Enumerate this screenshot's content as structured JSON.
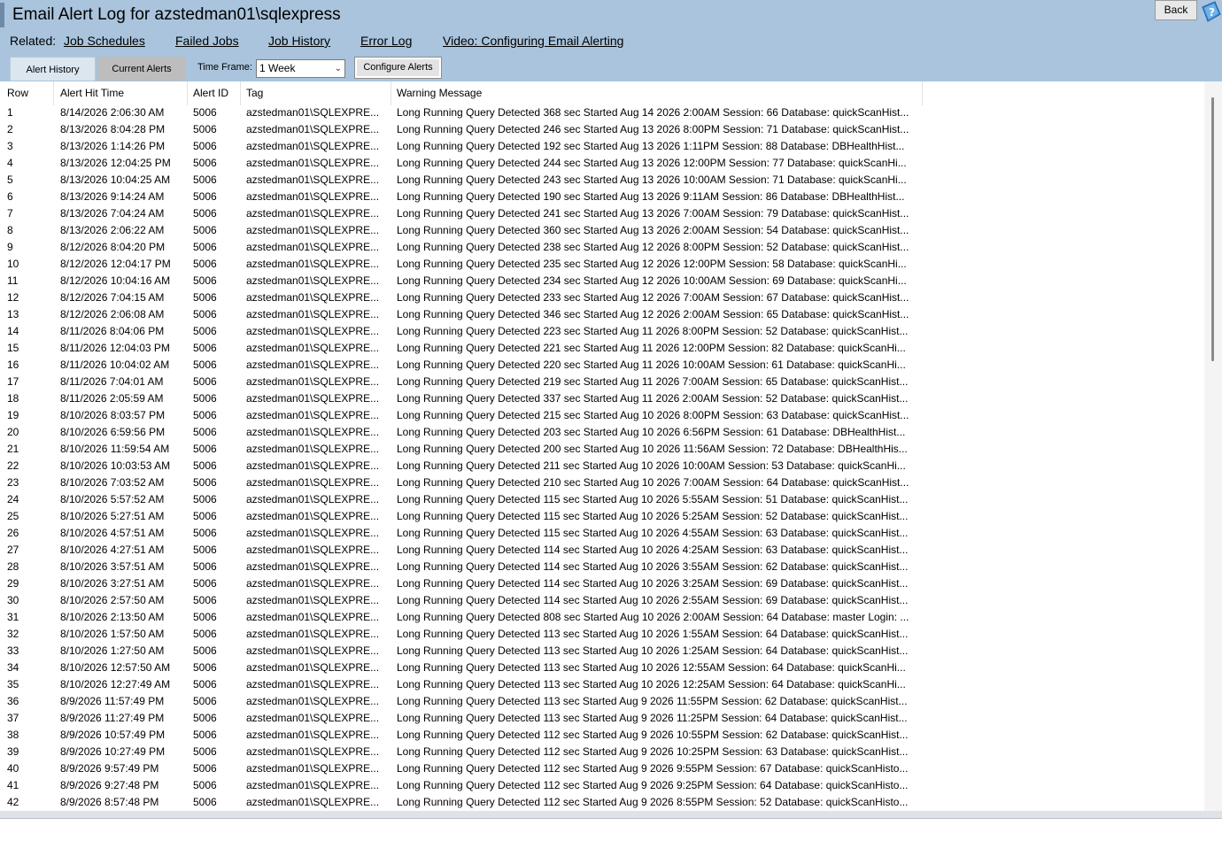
{
  "window": {
    "title": "Email Alert Log for azstedman01\\sqlexpress",
    "back_label": "Back"
  },
  "related": {
    "label": "Related:",
    "links": [
      "Job Schedules",
      "Failed Jobs",
      "Job History",
      "Error Log",
      "Video: Configuring Email Alerting"
    ]
  },
  "tabs": [
    "Alert History",
    "Current Alerts"
  ],
  "toolbar": {
    "timeframe_label": "Time Frame:",
    "timeframe_value": "1 Week",
    "configure_label": "Configure Alerts"
  },
  "icons": {
    "help": "help-icon",
    "dropdown": "chevron-down-icon"
  },
  "table": {
    "headers": [
      "Row",
      "Alert Hit Time",
      "Alert ID",
      "Tag",
      "Warning Message"
    ],
    "rows": [
      [
        "1",
        "8/14/2026 2:06:30 AM",
        "5006",
        "azstedman01\\SQLEXPRE...",
        "Long Running Query Detected 368 sec Started Aug 14 2026 2:00AM Session: 66 Database: quickScanHist..."
      ],
      [
        "2",
        "8/13/2026 8:04:28 PM",
        "5006",
        "azstedman01\\SQLEXPRE...",
        "Long Running Query Detected 246 sec Started Aug 13 2026 8:00PM Session: 71 Database: quickScanHist..."
      ],
      [
        "3",
        "8/13/2026 1:14:26 PM",
        "5006",
        "azstedman01\\SQLEXPRE...",
        "Long Running Query Detected 192 sec Started Aug 13 2026 1:11PM Session: 88 Database: DBHealthHist..."
      ],
      [
        "4",
        "8/13/2026 12:04:25 PM",
        "5006",
        "azstedman01\\SQLEXPRE...",
        "Long Running Query Detected 244 sec Started Aug 13 2026 12:00PM Session: 77 Database: quickScanHi..."
      ],
      [
        "5",
        "8/13/2026 10:04:25 AM",
        "5006",
        "azstedman01\\SQLEXPRE...",
        "Long Running Query Detected 243 sec Started Aug 13 2026 10:00AM Session: 71 Database: quickScanHi..."
      ],
      [
        "6",
        "8/13/2026 9:14:24 AM",
        "5006",
        "azstedman01\\SQLEXPRE...",
        "Long Running Query Detected 190 sec Started Aug 13 2026 9:11AM Session: 86 Database: DBHealthHist..."
      ],
      [
        "7",
        "8/13/2026 7:04:24 AM",
        "5006",
        "azstedman01\\SQLEXPRE...",
        "Long Running Query Detected 241 sec Started Aug 13 2026 7:00AM Session: 79 Database: quickScanHist..."
      ],
      [
        "8",
        "8/13/2026 2:06:22 AM",
        "5006",
        "azstedman01\\SQLEXPRE...",
        "Long Running Query Detected 360 sec Started Aug 13 2026 2:00AM Session: 54 Database: quickScanHist..."
      ],
      [
        "9",
        "8/12/2026 8:04:20 PM",
        "5006",
        "azstedman01\\SQLEXPRE...",
        "Long Running Query Detected 238 sec Started Aug 12 2026 8:00PM Session: 52 Database: quickScanHist..."
      ],
      [
        "10",
        "8/12/2026 12:04:17 PM",
        "5006",
        "azstedman01\\SQLEXPRE...",
        "Long Running Query Detected 235 sec Started Aug 12 2026 12:00PM Session: 58 Database: quickScanHi..."
      ],
      [
        "11",
        "8/12/2026 10:04:16 AM",
        "5006",
        "azstedman01\\SQLEXPRE...",
        "Long Running Query Detected 234 sec Started Aug 12 2026 10:00AM Session: 69 Database: quickScanHi..."
      ],
      [
        "12",
        "8/12/2026 7:04:15 AM",
        "5006",
        "azstedman01\\SQLEXPRE...",
        "Long Running Query Detected 233 sec Started Aug 12 2026 7:00AM Session: 67 Database: quickScanHist..."
      ],
      [
        "13",
        "8/12/2026 2:06:08 AM",
        "5006",
        "azstedman01\\SQLEXPRE...",
        "Long Running Query Detected 346 sec Started Aug 12 2026 2:00AM Session: 65 Database: quickScanHist..."
      ],
      [
        "14",
        "8/11/2026 8:04:06 PM",
        "5006",
        "azstedman01\\SQLEXPRE...",
        "Long Running Query Detected 223 sec Started Aug 11 2026 8:00PM Session: 52 Database: quickScanHist..."
      ],
      [
        "15",
        "8/11/2026 12:04:03 PM",
        "5006",
        "azstedman01\\SQLEXPRE...",
        "Long Running Query Detected 221 sec Started Aug 11 2026 12:00PM Session: 82 Database: quickScanHi..."
      ],
      [
        "16",
        "8/11/2026 10:04:02 AM",
        "5006",
        "azstedman01\\SQLEXPRE...",
        "Long Running Query Detected 220 sec Started Aug 11 2026 10:00AM Session: 61 Database: quickScanHi..."
      ],
      [
        "17",
        "8/11/2026 7:04:01 AM",
        "5006",
        "azstedman01\\SQLEXPRE...",
        "Long Running Query Detected 219 sec Started Aug 11 2026 7:00AM Session: 65 Database: quickScanHist..."
      ],
      [
        "18",
        "8/11/2026 2:05:59 AM",
        "5006",
        "azstedman01\\SQLEXPRE...",
        "Long Running Query Detected 337 sec Started Aug 11 2026 2:00AM Session: 52 Database: quickScanHist..."
      ],
      [
        "19",
        "8/10/2026 8:03:57 PM",
        "5006",
        "azstedman01\\SQLEXPRE...",
        "Long Running Query Detected 215 sec Started Aug 10 2026 8:00PM Session: 63 Database: quickScanHist..."
      ],
      [
        "20",
        "8/10/2026 6:59:56 PM",
        "5006",
        "azstedman01\\SQLEXPRE...",
        "Long Running Query Detected 203 sec Started Aug 10 2026 6:56PM Session: 61 Database: DBHealthHist..."
      ],
      [
        "21",
        "8/10/2026 11:59:54 AM",
        "5006",
        "azstedman01\\SQLEXPRE...",
        "Long Running Query Detected 200 sec Started Aug 10 2026 11:56AM Session: 72 Database: DBHealthHis..."
      ],
      [
        "22",
        "8/10/2026 10:03:53 AM",
        "5006",
        "azstedman01\\SQLEXPRE...",
        "Long Running Query Detected 211 sec Started Aug 10 2026 10:00AM Session: 53 Database: quickScanHi..."
      ],
      [
        "23",
        "8/10/2026 7:03:52 AM",
        "5006",
        "azstedman01\\SQLEXPRE...",
        "Long Running Query Detected 210 sec Started Aug 10 2026 7:00AM Session: 64 Database: quickScanHist..."
      ],
      [
        "24",
        "8/10/2026 5:57:52 AM",
        "5006",
        "azstedman01\\SQLEXPRE...",
        "Long Running Query Detected 115 sec Started Aug 10 2026 5:55AM Session: 51 Database: quickScanHist..."
      ],
      [
        "25",
        "8/10/2026 5:27:51 AM",
        "5006",
        "azstedman01\\SQLEXPRE...",
        "Long Running Query Detected 115 sec Started Aug 10 2026 5:25AM Session: 52 Database: quickScanHist..."
      ],
      [
        "26",
        "8/10/2026 4:57:51 AM",
        "5006",
        "azstedman01\\SQLEXPRE...",
        "Long Running Query Detected 115 sec Started Aug 10 2026 4:55AM Session: 63 Database: quickScanHist..."
      ],
      [
        "27",
        "8/10/2026 4:27:51 AM",
        "5006",
        "azstedman01\\SQLEXPRE...",
        "Long Running Query Detected 114 sec Started Aug 10 2026 4:25AM Session: 63 Database: quickScanHist..."
      ],
      [
        "28",
        "8/10/2026 3:57:51 AM",
        "5006",
        "azstedman01\\SQLEXPRE...",
        "Long Running Query Detected 114 sec Started Aug 10 2026 3:55AM Session: 62 Database: quickScanHist..."
      ],
      [
        "29",
        "8/10/2026 3:27:51 AM",
        "5006",
        "azstedman01\\SQLEXPRE...",
        "Long Running Query Detected 114 sec Started Aug 10 2026 3:25AM Session: 69 Database: quickScanHist..."
      ],
      [
        "30",
        "8/10/2026 2:57:50 AM",
        "5006",
        "azstedman01\\SQLEXPRE...",
        "Long Running Query Detected 114 sec Started Aug 10 2026 2:55AM Session: 69 Database: quickScanHist..."
      ],
      [
        "31",
        "8/10/2026 2:13:50 AM",
        "5006",
        "azstedman01\\SQLEXPRE...",
        "Long Running Query Detected 808 sec Started Aug 10 2026 2:00AM Session: 64 Database: master Login: ..."
      ],
      [
        "32",
        "8/10/2026 1:57:50 AM",
        "5006",
        "azstedman01\\SQLEXPRE...",
        "Long Running Query Detected 113 sec Started Aug 10 2026 1:55AM Session: 64 Database: quickScanHist..."
      ],
      [
        "33",
        "8/10/2026 1:27:50 AM",
        "5006",
        "azstedman01\\SQLEXPRE...",
        "Long Running Query Detected 113 sec Started Aug 10 2026 1:25AM Session: 64 Database: quickScanHist..."
      ],
      [
        "34",
        "8/10/2026 12:57:50 AM",
        "5006",
        "azstedman01\\SQLEXPRE...",
        "Long Running Query Detected 113 sec Started Aug 10 2026 12:55AM Session: 64 Database: quickScanHi..."
      ],
      [
        "35",
        "8/10/2026 12:27:49 AM",
        "5006",
        "azstedman01\\SQLEXPRE...",
        "Long Running Query Detected 113 sec Started Aug 10 2026 12:25AM Session: 64 Database: quickScanHi..."
      ],
      [
        "36",
        "8/9/2026 11:57:49 PM",
        "5006",
        "azstedman01\\SQLEXPRE...",
        "Long Running Query Detected 113 sec Started Aug 9 2026 11:55PM Session: 62 Database: quickScanHist..."
      ],
      [
        "37",
        "8/9/2026 11:27:49 PM",
        "5006",
        "azstedman01\\SQLEXPRE...",
        "Long Running Query Detected 113 sec Started Aug 9 2026 11:25PM Session: 64 Database: quickScanHist..."
      ],
      [
        "38",
        "8/9/2026 10:57:49 PM",
        "5006",
        "azstedman01\\SQLEXPRE...",
        "Long Running Query Detected 112 sec Started Aug 9 2026 10:55PM Session: 62 Database: quickScanHist..."
      ],
      [
        "39",
        "8/9/2026 10:27:49 PM",
        "5006",
        "azstedman01\\SQLEXPRE...",
        "Long Running Query Detected 112 sec Started Aug 9 2026 10:25PM Session: 63 Database: quickScanHist..."
      ],
      [
        "40",
        "8/9/2026 9:57:49 PM",
        "5006",
        "azstedman01\\SQLEXPRE...",
        "Long Running Query Detected 112 sec Started Aug 9 2026 9:55PM Session: 67 Database: quickScanHisto..."
      ],
      [
        "41",
        "8/9/2026 9:27:48 PM",
        "5006",
        "azstedman01\\SQLEXPRE...",
        "Long Running Query Detected 112 sec Started Aug 9 2026 9:25PM Session: 64 Database: quickScanHisto..."
      ],
      [
        "42",
        "8/9/2026 8:57:48 PM",
        "5006",
        "azstedman01\\SQLEXPRE...",
        "Long Running Query Detected 112 sec Started Aug 9 2026 8:55PM Session: 52 Database: quickScanHisto..."
      ]
    ]
  }
}
